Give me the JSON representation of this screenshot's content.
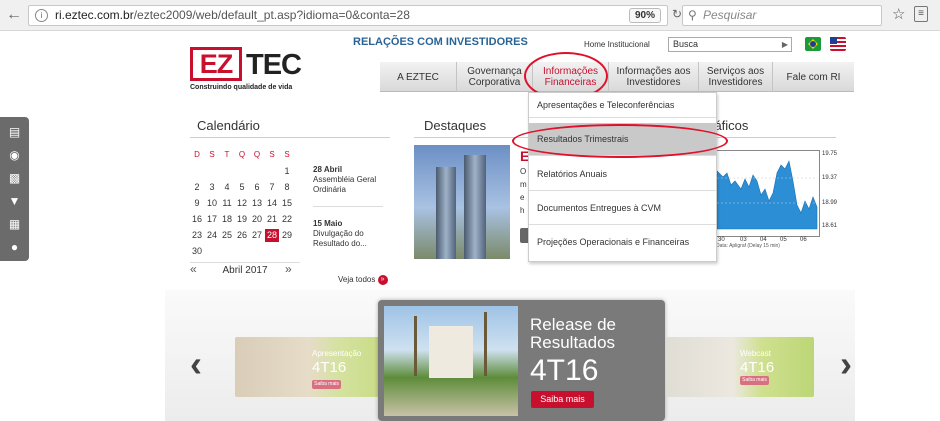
{
  "browser": {
    "url_host": "ri.eztec.com.br",
    "url_path": "/eztec2009/web/default_pt.asp?idioma=0&conta=28",
    "zoom": "90%",
    "search_placeholder": "Pesquisar"
  },
  "header": {
    "logo_ez": "EZ",
    "logo_tec": "TEC",
    "tagline": "Construindo qualidade de vida",
    "ri_title": "RELAÇÕES COM INVESTIDORES",
    "home_link": "Home Institucional",
    "search_value": "Busca"
  },
  "nav": {
    "items": [
      {
        "label": "A EZTEC"
      },
      {
        "label": "Governança Corporativa"
      },
      {
        "label": "Informações Financeiras"
      },
      {
        "label": "Informações aos Investidores"
      },
      {
        "label": "Serviços aos Investidores"
      },
      {
        "label": "Fale com RI"
      }
    ]
  },
  "dropdown": {
    "items": [
      {
        "label": "Apresentações e Teleconferências"
      },
      {
        "label": "Resultados Trimestrais"
      },
      {
        "label": "Relatórios Anuais"
      },
      {
        "label": "Documentos Entregues à CVM"
      },
      {
        "label": "Projeções Operacionais e Financeiras"
      }
    ]
  },
  "calendar": {
    "title": "Calendário",
    "weekdays": [
      "D",
      "S",
      "T",
      "Q",
      "Q",
      "S",
      "S"
    ],
    "weeks": [
      [
        "",
        "",
        "",
        "",
        "",
        "",
        "1"
      ],
      [
        "2",
        "3",
        "4",
        "5",
        "6",
        "7",
        "8"
      ],
      [
        "9",
        "10",
        "11",
        "12",
        "13",
        "14",
        "15"
      ],
      [
        "16",
        "17",
        "18",
        "19",
        "20",
        "21",
        "22"
      ],
      [
        "23",
        "24",
        "25",
        "26",
        "27",
        "28",
        "29"
      ],
      [
        "30",
        "",
        "",
        "",
        "",
        "",
        ""
      ]
    ],
    "highlight": "28",
    "month_label": "Abril 2017",
    "events": [
      {
        "date": "28 Abril",
        "text": "Assembléia Geral Ordinária"
      },
      {
        "date": "15 Maio",
        "text": "Divulgação do Resultado do..."
      }
    ],
    "see_all": "Veja todos"
  },
  "destaques": {
    "title": "Destaques",
    "teaser_lines": [
      "E",
      "O",
      "m",
      "e",
      "h"
    ]
  },
  "graficos": {
    "title": "Gráficos",
    "y_ticks": [
      "19.75",
      "19.37",
      "18.99",
      "18.61"
    ],
    "x_ticks": [
      "30",
      "03",
      "04",
      "05",
      "06"
    ],
    "footer": "Data: Apligraf (Delay 15 min)"
  },
  "carousel": {
    "left_card": {
      "label": "Apresentação",
      "value": "4T16",
      "button": "Saiba mais"
    },
    "main_card": {
      "title_line1": "Release de",
      "title_line2": "Resultados",
      "value": "4T16",
      "button": "Saiba mais"
    },
    "right_card": {
      "label": "Webcast",
      "value": "4T16",
      "button": "Saiba mais"
    }
  },
  "colors": {
    "brand_red": "#c8102e",
    "ri_blue": "#2a6496",
    "annotation_red": "#e0102a"
  }
}
